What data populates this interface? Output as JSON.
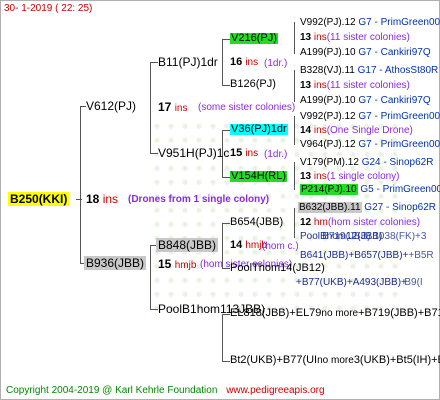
{
  "header": {
    "date": "30-   1-2019  (  22:  25)"
  },
  "footer": {
    "copyright": "Copyright 2004-2019 @ Karl Kehrle Foundation",
    "url": "www.pedigreeapis.org"
  },
  "root": {
    "name": "B250(KKI)",
    "ins": "18",
    "ins_label": "ins",
    "note": "(Drones from 1 single colony)"
  },
  "g1": {
    "top": {
      "name": "V612(PJ)",
      "ins": "17",
      "ins_label": "ins",
      "note": "(some sister colonies)"
    },
    "bottom": {
      "name": "B936(JBB)",
      "ins": "15",
      "ins_label": "hmjb",
      "note": "(hom sister colonies)"
    }
  },
  "g2": {
    "a": {
      "name": "B11(PJ)1dr",
      "ins": "16",
      "ins_label": "ins",
      "note": "(1dr.)"
    },
    "b": {
      "name": "V951H(PJ)1c",
      "ins": "15",
      "ins_label": "ins",
      "note": "(1dr.)"
    },
    "c": {
      "name": "B848(JBB)",
      "ins": "14",
      "ins_label": "hmjb",
      "note": "(hom c.)"
    },
    "d": {
      "name": "PoolB1hom11",
      "suffix": "3JBB)"
    }
  },
  "g3": [
    {
      "name": "V216(PJ)"
    },
    {
      "name": "B126(PJ)"
    },
    {
      "name": "V36(PJ)1dr"
    },
    {
      "name": "V154H(RL)"
    },
    {
      "name": "B654(JBB)"
    },
    {
      "name": "PoolThom14(JB",
      "suffix": "12)"
    },
    {
      "name": "EL818(JBB)+EL79",
      "suffix": "no more",
      "suffix2": "+B719(JBB)+B717("
    },
    {
      "name": "Bt2(UKB)+B77(UI",
      "suffix": "no more",
      "suffix2": "3(UKB)+Bt5(IH)+Bt"
    }
  ],
  "g4": [
    {
      "name": "V992(PJ).12",
      "info": "G7 - PrimGreen00"
    },
    {
      "ins": "13",
      "ins_label": "ins",
      "note": "(11 sister colonies)"
    },
    {
      "name": "A199(PJ).10",
      "info": "G7 - Cankiri97Q"
    },
    {
      "name": "B328(VJ).11",
      "info": "G17 - AthosSt80R"
    },
    {
      "ins": "13",
      "ins_label": "ins",
      "note": "(11 sister colonies)"
    },
    {
      "name": "A199(PJ).10",
      "info": "G7 - Cankiri97Q"
    },
    {
      "name": "V992(PJ).12",
      "info": "G7 - PrimGreen00"
    },
    {
      "ins": "14",
      "ins_label": "ins",
      "note": "(One Single Drone)"
    },
    {
      "name": "V964(PJ).12",
      "info": "G7 - PrimGreen00"
    },
    {
      "name": "V179(PM).12",
      "info": "G24 - Sinop62R"
    },
    {
      "ins": "13",
      "ins_label": "ins",
      "note": "(1 single colony)"
    },
    {
      "name": "P214(PJ).10",
      "info": "G5 - PrimGreen00"
    },
    {
      "name": "B632(JBB).11",
      "info": "G27 - Sinop62R"
    },
    {
      "ins": "12",
      "ins_label": "hm",
      "note": "(hom sister colonies)"
    },
    {
      "name": "PoolBhom12(JBB)",
      "overlap": "        B719(JBB).1038(FK)+3"
    },
    {
      "name": "B641(JBB)+B657(JBB)+",
      "overlap": "                                       +B5R"
    },
    {
      "name": "+B77(UKB)+A493(JBB)+",
      "overlap": "                                       B9(I"
    }
  ],
  "colors": {
    "root_bg": "#ffff00",
    "green_box": "#22dd22",
    "cyan_box": "#00ffff",
    "gray_box": "#c8c8c8",
    "line": "#555555"
  }
}
